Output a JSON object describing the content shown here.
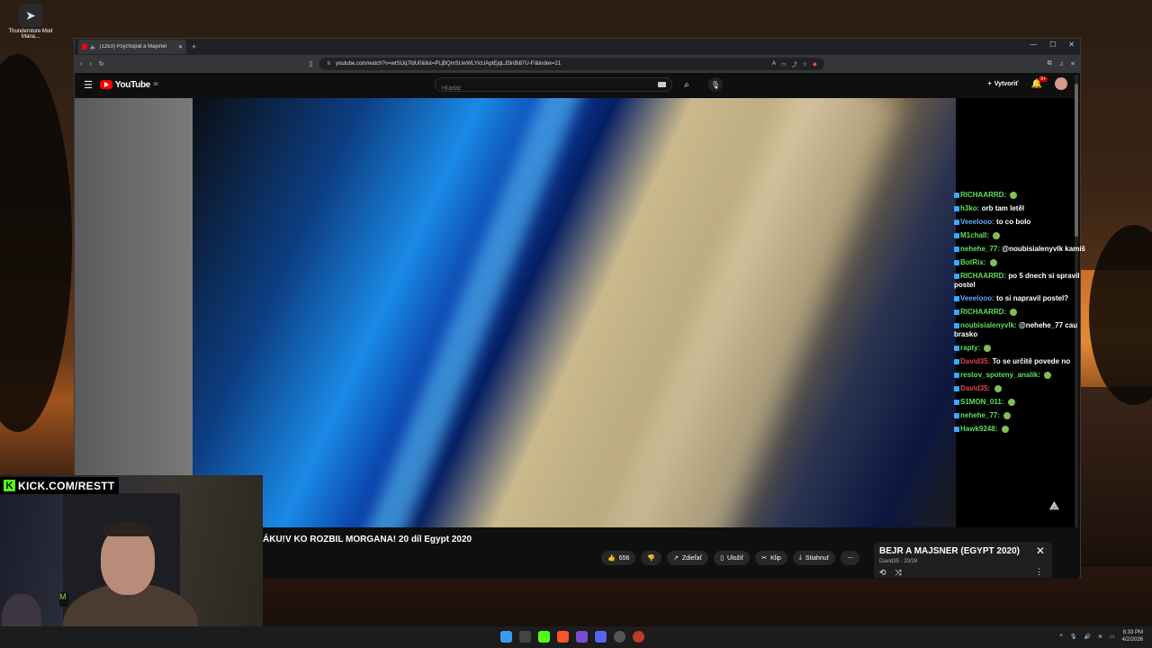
{
  "desktop": {
    "icon_label": "Thunderstore Mod Mana..."
  },
  "browser": {
    "tab_title": "(1253) Psychopat a Majsner",
    "url": "youtube.com/watch?v=wtSIJq7fdU0&list=PLjBQmSUwWLYicUAptEjqLJ5lnBi87U-Fi&index=21"
  },
  "youtube": {
    "logo_text": "YouTube",
    "logo_sup": "SK",
    "search_placeholder": "Hľadať",
    "create_label": "Vytvoriť",
    "notif_badge": "9+"
  },
  "video": {
    "title": "ÁKU!V KO ROZBIL MORGANA! 20 díl Egypt 2020",
    "actions": {
      "likes": "656",
      "share": "Zdieľať",
      "save": "Uložiť",
      "clip": "Klip",
      "download": "Stiahnuť"
    }
  },
  "playlist": {
    "title": "BEJR A MAJSNER (EGYPT 2020)",
    "sub": "David35 · 20/26"
  },
  "chat": [
    {
      "user": "RICHAARRD:",
      "text": "",
      "color": "#5ee05e"
    },
    {
      "user": "h3ko:",
      "text": "orb tam letěl",
      "color": "#5ee05e"
    },
    {
      "user": "Veeelooo:",
      "text": "to co bolo",
      "color": "#5aa9ff"
    },
    {
      "user": "M1chall:",
      "text": "",
      "color": "#5ee05e"
    },
    {
      "user": "nehehe_77:",
      "text": "@noubisialenyvlk kamiš",
      "color": "#5ee05e"
    },
    {
      "user": "BotRix:",
      "text": "",
      "color": "#5ee05e"
    },
    {
      "user": "RICHAARRD:",
      "text": "po 5 dnech si spravil postel",
      "color": "#5ee05e"
    },
    {
      "user": "Veeelooo:",
      "text": "to si napravil postel?",
      "color": "#5aa9ff"
    },
    {
      "user": "RICHAARRD:",
      "text": "",
      "color": "#5ee05e"
    },
    {
      "user": "noubisialenyvlk:",
      "text": "@nehehe_77 cau brasko",
      "color": "#5ee05e"
    },
    {
      "user": "rapty:",
      "text": "",
      "color": "#5ee05e"
    },
    {
      "user": "David35:",
      "text": "To se určitě povede no",
      "color": "#e04a4a"
    },
    {
      "user": "restov_spoteny_analik:",
      "text": "",
      "color": "#5ee05e"
    },
    {
      "user": "David35:",
      "text": "",
      "color": "#e04a4a"
    },
    {
      "user": "S1MON_011:",
      "text": "",
      "color": "#5ee05e"
    },
    {
      "user": "nehehe_77:",
      "text": "",
      "color": "#5ee05e"
    },
    {
      "user": "Hawk9248:",
      "text": "",
      "color": "#5ee05e"
    }
  ],
  "stream": {
    "kick_label": "KICK.COM/RESTT"
  },
  "taskbar": {
    "time": "8:33 PM",
    "date": "4/2/2026"
  }
}
